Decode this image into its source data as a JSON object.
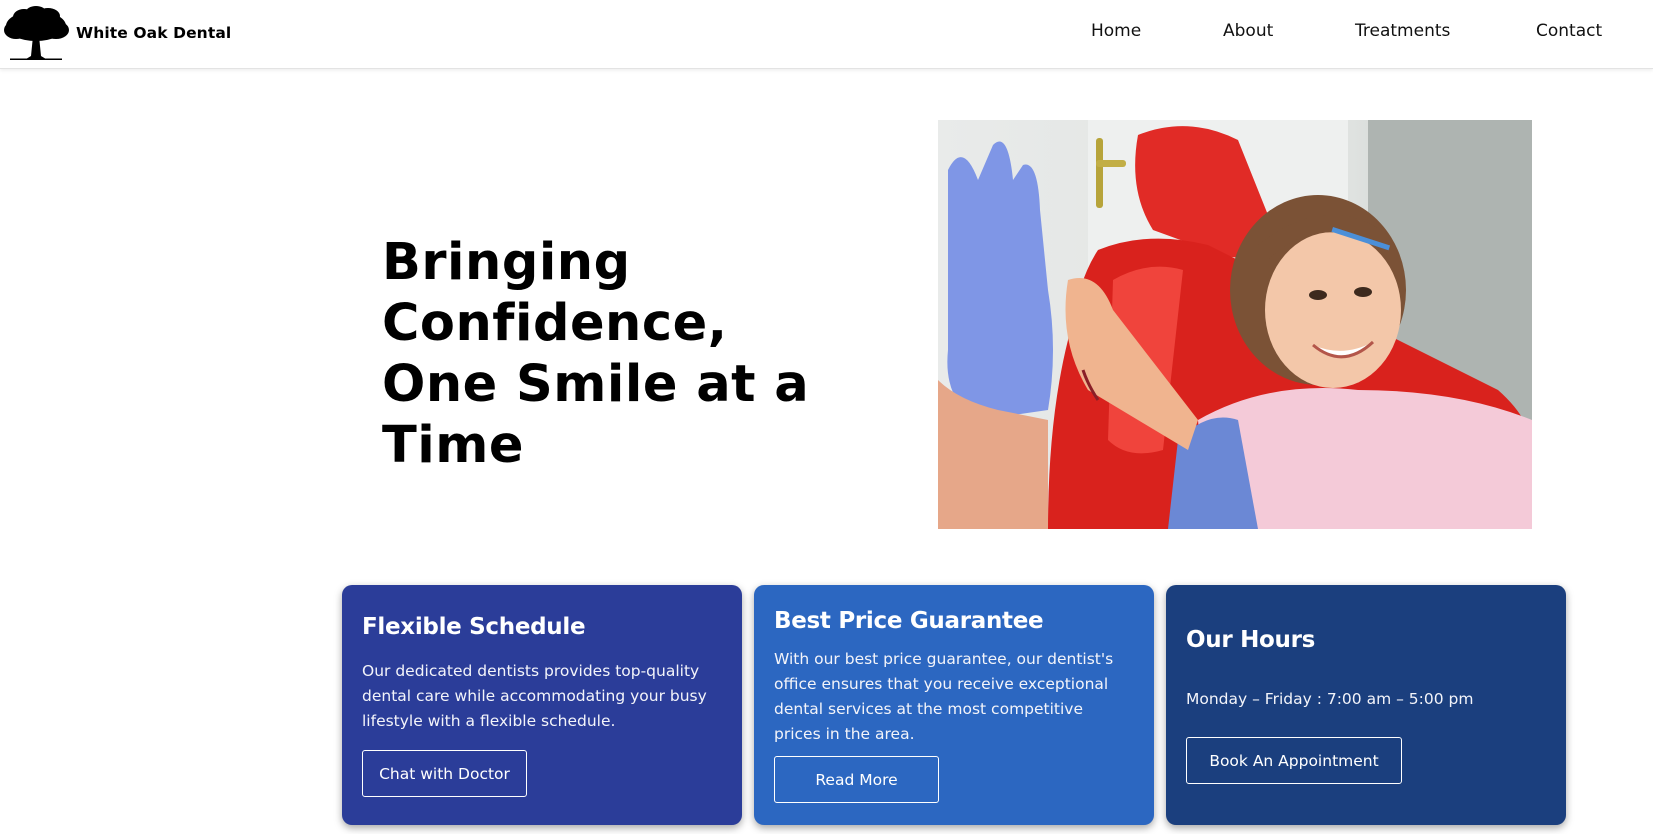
{
  "header": {
    "brand_name": "White Oak Dental",
    "logo_icon": "oak-tree-icon",
    "nav": [
      "Home",
      "About",
      "Treatments",
      "Contact"
    ]
  },
  "hero": {
    "title": "Bringing Confidence, One Smile at a Time",
    "image": "photo-child-high-five-dentist"
  },
  "cards": [
    {
      "title": "Flexible Schedule",
      "text": "Our dedicated dentists provides top-quality dental care while accommodating your busy lifestyle with a flexible schedule.",
      "button": "Chat with Doctor",
      "color": "#2b3d99"
    },
    {
      "title": "Best Price Guarantee",
      "text": "With our best price guarantee, our dentist's office ensures that you receive exceptional dental services at the most competitive prices in the area.",
      "button": "Read More",
      "color": "#2c67c1"
    },
    {
      "title": "Our Hours",
      "text": "Monday – Friday : 7:00 am – 5:00 pm",
      "button": "Book An Appointment",
      "color": "#1b3f7e"
    }
  ]
}
